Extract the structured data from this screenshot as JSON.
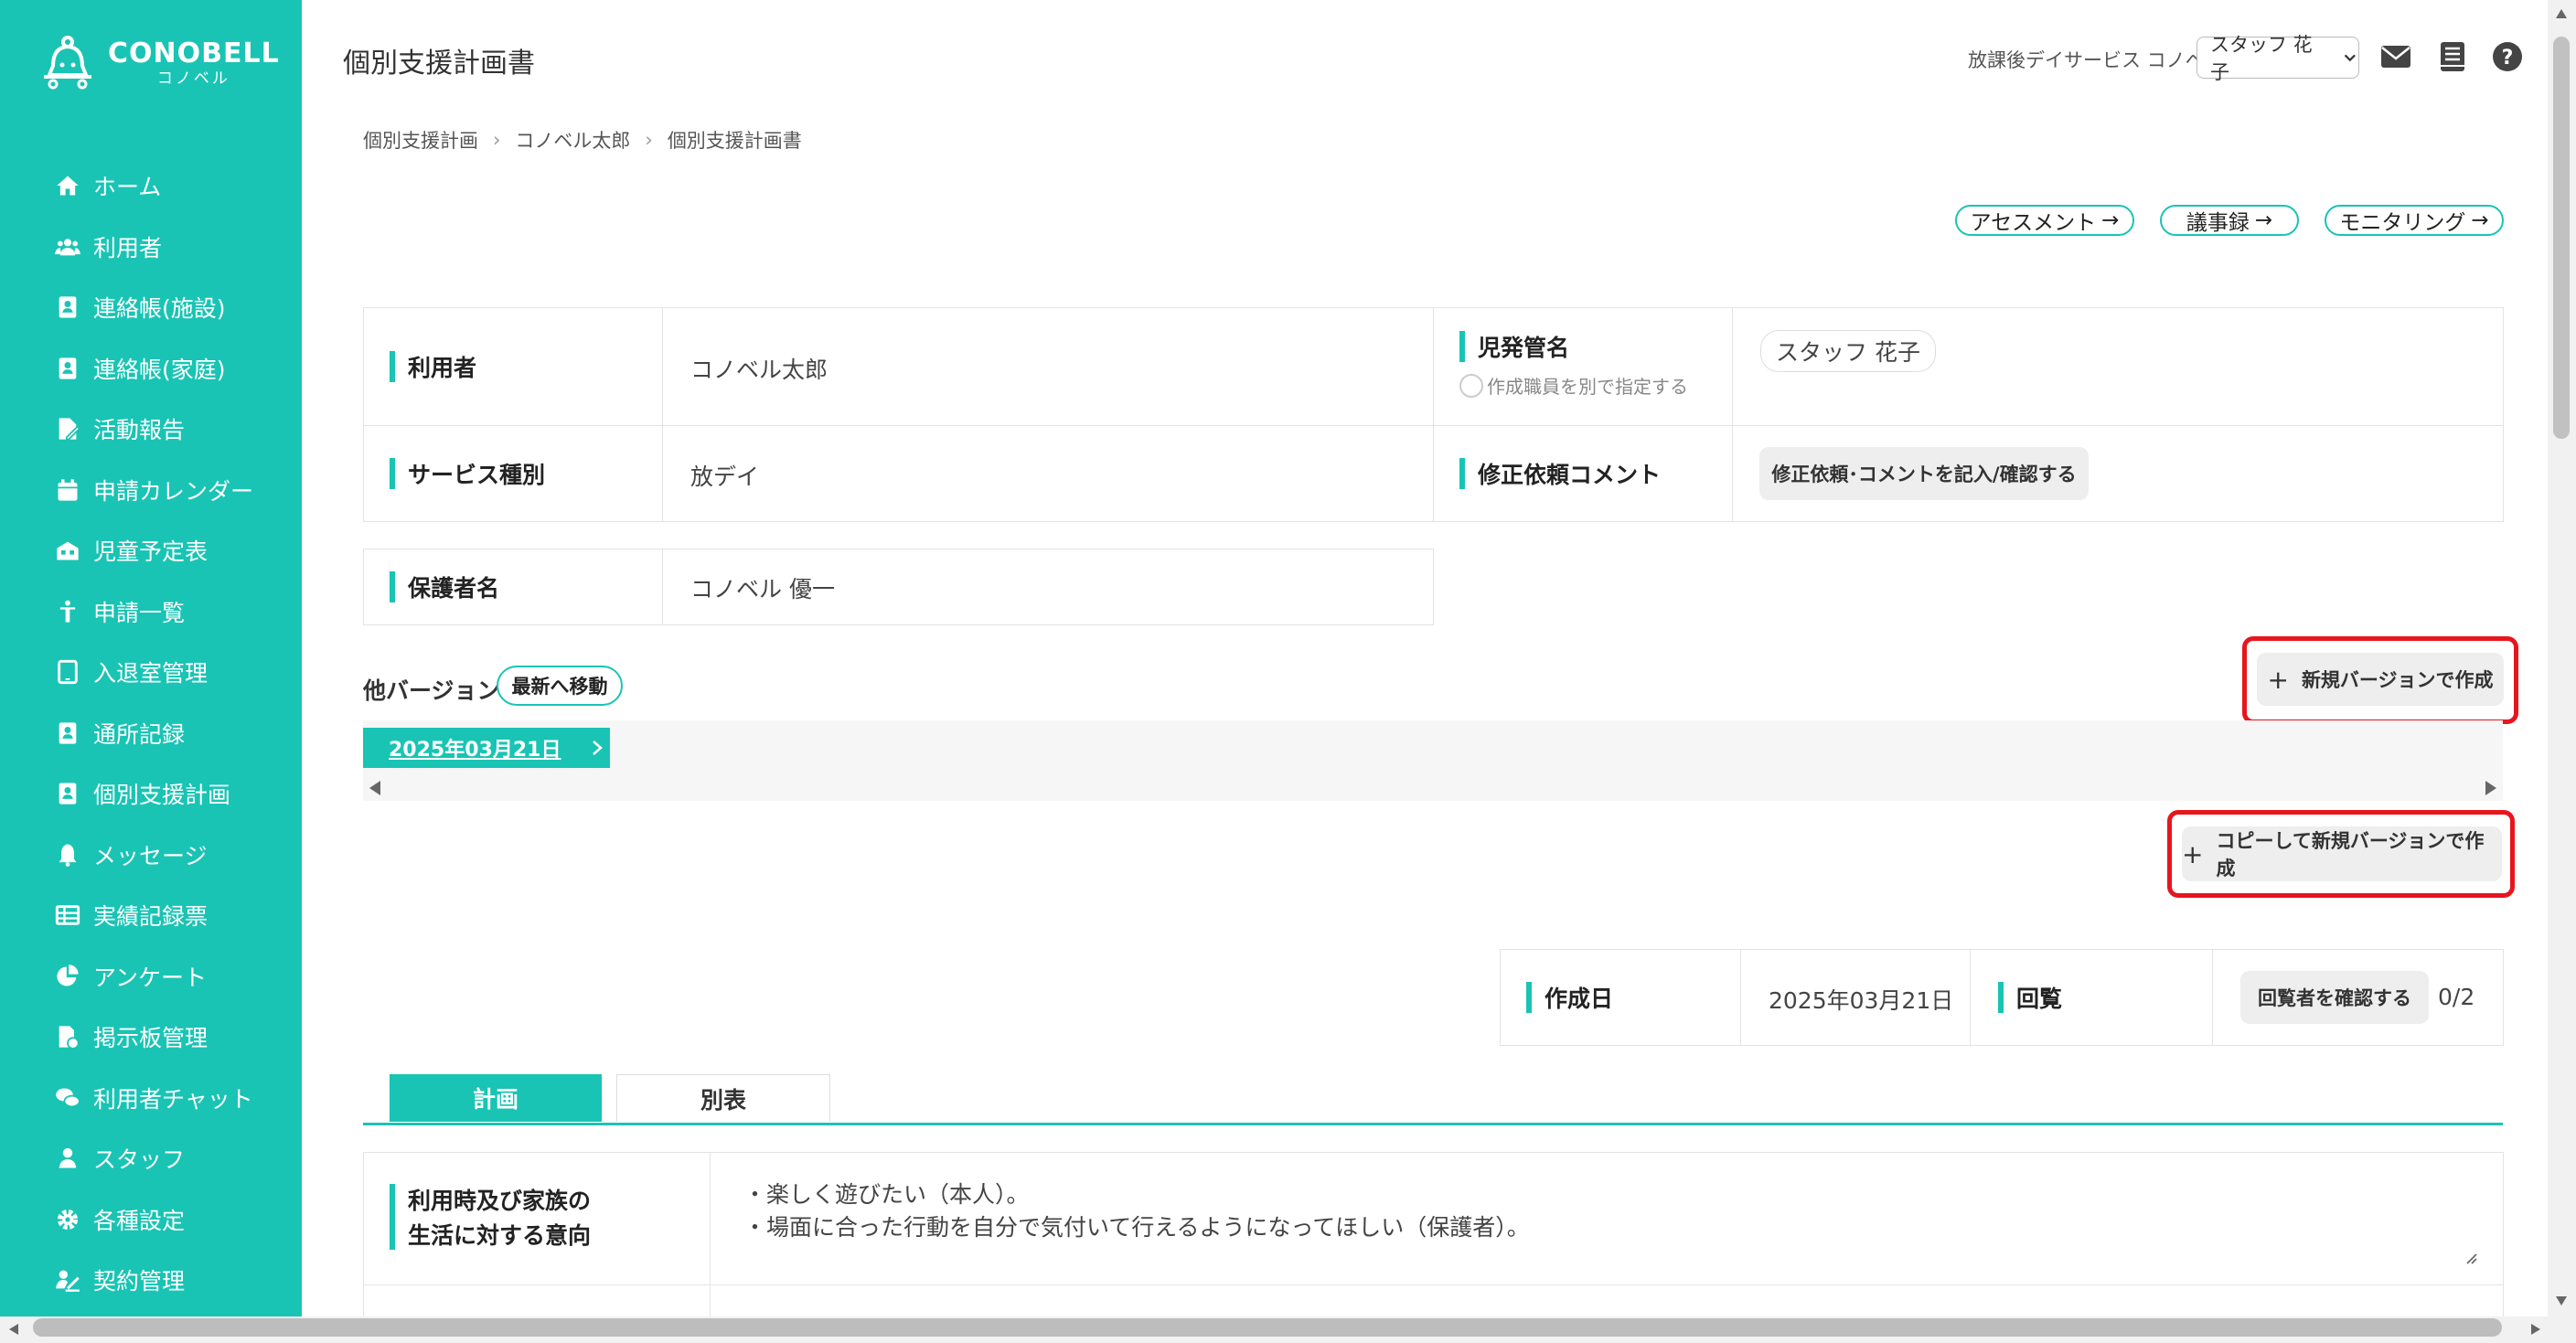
{
  "app": {
    "brand": "CONOBELL",
    "brand_sub": "コノベル",
    "accent": "#19c4b4"
  },
  "sidebar": {
    "items": [
      {
        "label": "ホーム",
        "icon": "home-icon"
      },
      {
        "label": "利用者",
        "icon": "users-icon"
      },
      {
        "label": "連絡帳(施設)",
        "icon": "contact-book-icon"
      },
      {
        "label": "連絡帳(家庭)",
        "icon": "contact-book-icon"
      },
      {
        "label": "活動報告",
        "icon": "report-icon"
      },
      {
        "label": "申請カレンダー",
        "icon": "calendar-icon"
      },
      {
        "label": "児童予定表",
        "icon": "schedule-icon"
      },
      {
        "label": "申請一覧",
        "icon": "person-icon"
      },
      {
        "label": "入退室管理",
        "icon": "tablet-icon"
      },
      {
        "label": "通所記録",
        "icon": "contact-book-icon"
      },
      {
        "label": "個別支援計画",
        "icon": "contact-book-icon"
      },
      {
        "label": "メッセージ",
        "icon": "bell-icon"
      },
      {
        "label": "実績記録票",
        "icon": "table-icon"
      },
      {
        "label": "アンケート",
        "icon": "pie-chart-icon"
      },
      {
        "label": "掲示板管理",
        "icon": "board-icon"
      },
      {
        "label": "利用者チャット",
        "icon": "chat-icon"
      },
      {
        "label": "スタッフ",
        "icon": "staff-icon"
      },
      {
        "label": "各種設定",
        "icon": "gear-icon"
      },
      {
        "label": "契約管理",
        "icon": "contract-icon"
      }
    ]
  },
  "header": {
    "title": "個別支援計画書",
    "facility": "放課後デイサービス コノベル",
    "staff": "スタッフ 花子"
  },
  "breadcrumb": [
    "個別支援計画",
    "コノベル太郎",
    "個別支援計画書"
  ],
  "links": {
    "assessment": "アセスメント",
    "minutes": "議事録",
    "monitoring": "モニタリング"
  },
  "info": {
    "user_label": "利用者",
    "user_value": "コノベル太郎",
    "manager_label": "児発管名",
    "manager_value": "スタッフ 花子",
    "manager_radio": "作成職員を別で指定する",
    "service_label": "サービス種別",
    "service_value": "放デイ",
    "comment_label": "修正依頼コメント",
    "comment_button": "修正依頼･コメントを記入/確認する",
    "guardian_label": "保護者名",
    "guardian_value": "コノベル 優一"
  },
  "versions": {
    "label": "他バージョン：",
    "latest_button": "最新へ移動",
    "new_button": "新規バージョンで作成",
    "copy_button": "コピーして新規バージョンで作成",
    "current": "2025年03月21日"
  },
  "meta": {
    "created_label": "作成日",
    "created_value": "2025年03月21日",
    "circulation_label": "回覧",
    "circulation_button": "回覧者を確認する",
    "circulation_count": "0/2"
  },
  "tabs": [
    "計画",
    "別表"
  ],
  "plan": {
    "intent_label_1": "利用時及び家族の",
    "intent_label_2": "生活に対する意向",
    "intent_line_1": "・楽しく遊びたい（本人）。",
    "intent_line_2": "・場面に合った行動を自分で気付いて行えるようになってほしい（保護者）。"
  }
}
